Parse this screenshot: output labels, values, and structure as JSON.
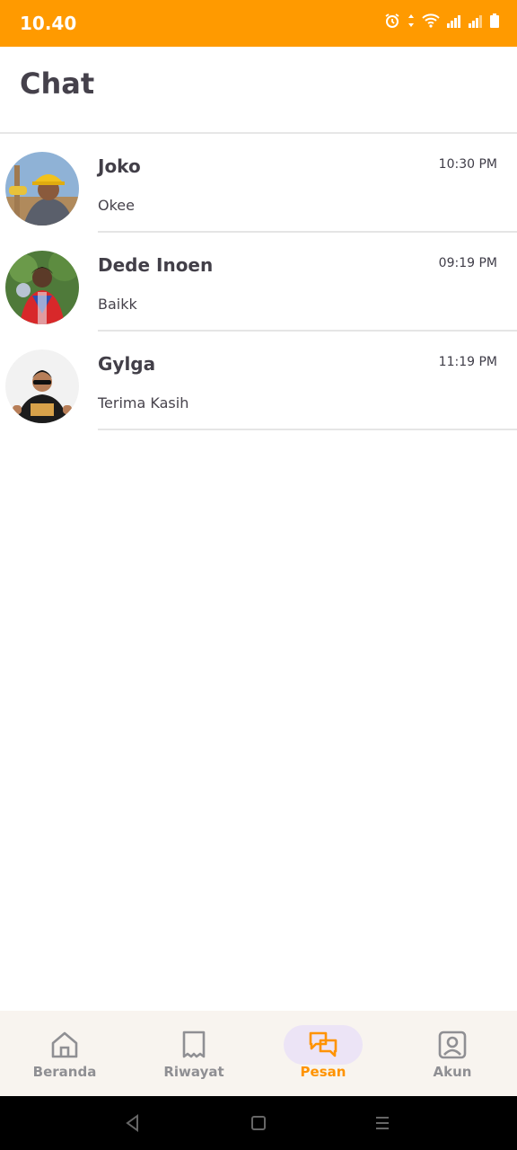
{
  "status": {
    "time": "10.40",
    "icons": [
      "alarm-icon",
      "data-transfer-icon",
      "wifi-icon",
      "signal-icon",
      "signal-icon",
      "battery-icon"
    ],
    "bar_color": "#ff9a00"
  },
  "header": {
    "title": "Chat"
  },
  "chats": [
    {
      "name": "Joko",
      "time": "10:30 PM",
      "message": "Okee",
      "avatar": "avatar-photo"
    },
    {
      "name": "Dede Inoen",
      "time": "09:19 PM",
      "message": "Baikk",
      "avatar": "avatar-photo"
    },
    {
      "name": "Gylga",
      "time": "11:19 PM",
      "message": "Terima Kasih",
      "avatar": "avatar-photo"
    }
  ],
  "bottom_nav": {
    "items": [
      {
        "label": "Beranda",
        "icon": "home-icon",
        "active": false
      },
      {
        "label": "Riwayat",
        "icon": "receipt-icon",
        "active": false
      },
      {
        "label": "Pesan",
        "icon": "chat-icon",
        "active": true
      },
      {
        "label": "Akun",
        "icon": "account-icon",
        "active": false
      }
    ],
    "active_color": "#ff9300",
    "inactive_color": "#8f8f93"
  },
  "system_nav": {
    "icons": [
      "back-icon",
      "home-square-icon",
      "menu-icon"
    ]
  }
}
